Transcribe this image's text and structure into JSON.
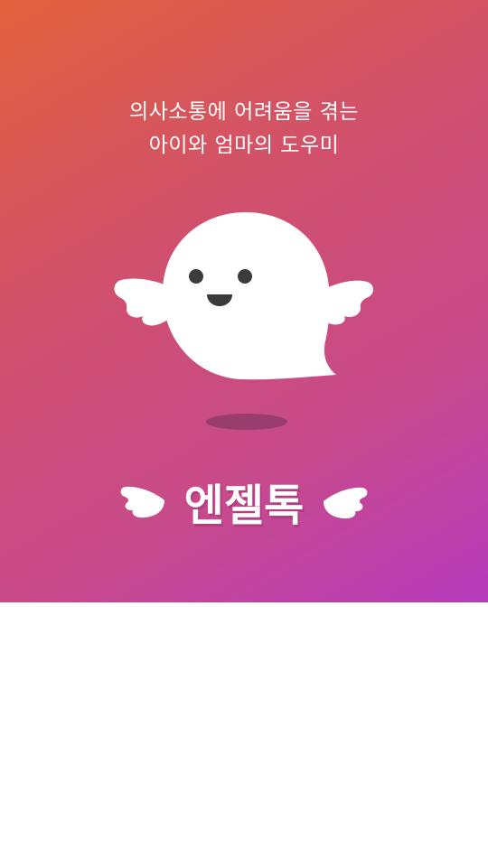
{
  "splash": {
    "tagline_line1": "의사소통에 어려움을 겪는",
    "tagline_line2": "아이와 엄마의 도우미",
    "mascot_icon": "winged-ghost-icon",
    "app_name": "엔젤톡",
    "left_wing_icon": "wing-icon",
    "right_wing_icon": "wing-icon"
  },
  "colors": {
    "gradient_start": "#e2613c",
    "gradient_end": "#b63bbd",
    "text": "#ffffff",
    "background": "#ffffff"
  }
}
